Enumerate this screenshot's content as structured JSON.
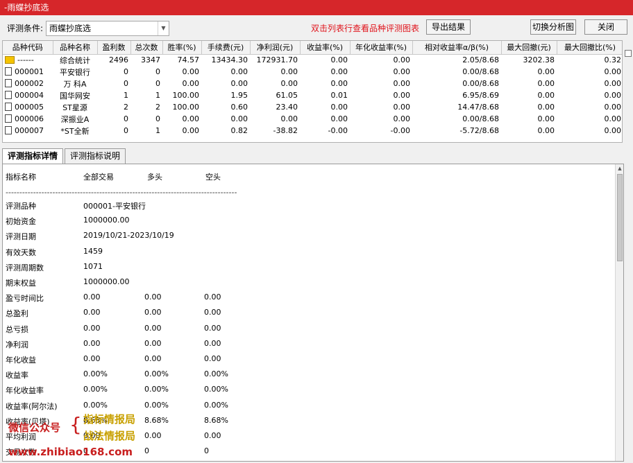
{
  "window": {
    "title": "-雨蝶抄底选"
  },
  "toolbar": {
    "condition_label": "评测条件:",
    "condition_value": "雨蝶抄底选",
    "hint": "双击列表行查看品种评测图表",
    "export_label": "导出结果",
    "switch_label": "切换分析图",
    "close_label": "关闭"
  },
  "grid": {
    "headers": [
      "品种代码",
      "品种名称",
      "盈利数",
      "总次数",
      "胜率(%)",
      "手续费(元)",
      "净利润(元)",
      "收益率(%)",
      "年化收益率(%)",
      "相对收益率α/β(%)",
      "最大回撤(元)",
      "最大回撤比(%)"
    ],
    "rows": [
      [
        "------",
        "综合统计",
        "2496",
        "3347",
        "74.57",
        "13434.30",
        "172931.70",
        "0.00",
        "0.00",
        "2.05/8.68",
        "3202.38",
        "0.32"
      ],
      [
        "000001",
        "平安银行",
        "0",
        "0",
        "0.00",
        "0.00",
        "0.00",
        "0.00",
        "0.00",
        "0.00/8.68",
        "0.00",
        "0.00"
      ],
      [
        "000002",
        "万 科A",
        "0",
        "0",
        "0.00",
        "0.00",
        "0.00",
        "0.00",
        "0.00",
        "0.00/8.68",
        "0.00",
        "0.00"
      ],
      [
        "000004",
        "国华网安",
        "1",
        "1",
        "100.00",
        "1.95",
        "61.05",
        "0.01",
        "0.00",
        "6.95/8.69",
        "0.00",
        "0.00"
      ],
      [
        "000005",
        "ST星源",
        "2",
        "2",
        "100.00",
        "0.60",
        "23.40",
        "0.00",
        "0.00",
        "14.47/8.68",
        "0.00",
        "0.00"
      ],
      [
        "000006",
        "深振业A",
        "0",
        "0",
        "0.00",
        "0.00",
        "0.00",
        "0.00",
        "0.00",
        "0.00/8.68",
        "0.00",
        "0.00"
      ],
      [
        "000007",
        "*ST全新",
        "0",
        "1",
        "0.00",
        "0.82",
        "-38.82",
        "-0.00",
        "-0.00",
        "-5.72/8.68",
        "0.00",
        "0.00"
      ]
    ]
  },
  "tabs": {
    "details": "评测指标详情",
    "description": "评测指标说明"
  },
  "detail": {
    "header": [
      "指标名称",
      "全部交易",
      "多头",
      "空头"
    ],
    "dashes": "------------------------------------------------------------------------------------",
    "rows": [
      [
        "评测品种",
        "000001-平安银行",
        "",
        ""
      ],
      [
        "初始资金",
        "1000000.00",
        "",
        ""
      ],
      [
        "评测日期",
        "2019/10/21-2023/10/19",
        "",
        ""
      ],
      [
        "有效天数",
        "1459",
        "",
        ""
      ],
      [
        "评测周期数",
        " 1071",
        "",
        ""
      ],
      [
        "期末权益",
        "1000000.00",
        "",
        ""
      ],
      [
        "盈亏时间比",
        "  0.00",
        "0.00",
        "0.00"
      ],
      [
        "总盈利",
        "0.00",
        "0.00",
        "0.00"
      ],
      [
        "总亏损",
        "0.00",
        "0.00",
        "0.00"
      ],
      [
        "净利润",
        "0.00",
        "0.00",
        "0.00"
      ],
      [
        "年化收益",
        "  0.00",
        "0.00",
        "0.00"
      ],
      [
        "收益率",
        "0.00%",
        "0.00%",
        "0.00%"
      ],
      [
        "年化收益率",
        "  0.00%",
        "0.00%",
        "0.00%"
      ],
      [
        "收益率(阿尔法)",
        "  0.00%",
        "0.00%",
        "0.00%"
      ],
      [
        "收益率(贝塔)",
        "  8.68%",
        "8.68%",
        "8.68%"
      ],
      [
        "平均利润",
        "0.00",
        "0.00",
        "0.00"
      ],
      [
        "交易次数",
        "0",
        "0",
        "0"
      ]
    ]
  },
  "watermark": {
    "wechat": "微信公众号",
    "brace": "{",
    "line1": "指标情报局",
    "line2": "战法情报局",
    "site": "www.zhibiao168.com"
  }
}
